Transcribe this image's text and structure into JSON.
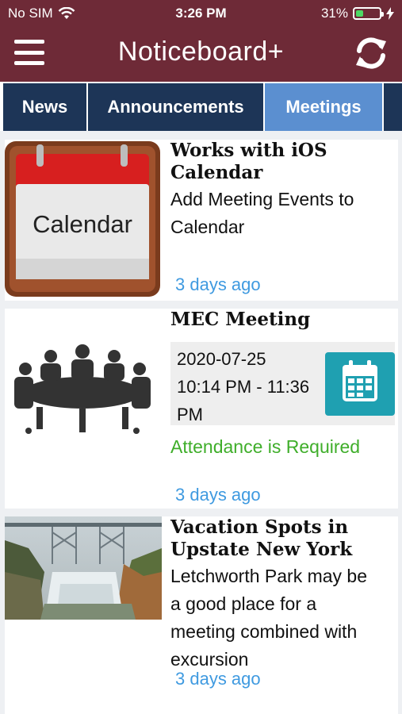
{
  "status_bar": {
    "carrier": "No SIM",
    "time": "3:26 PM",
    "battery": "31%",
    "battery_level": 0.31
  },
  "nav": {
    "title": "Noticeboard+"
  },
  "tabs": [
    {
      "label": "News",
      "active": false
    },
    {
      "label": "Announcements",
      "active": false
    },
    {
      "label": "Meetings",
      "active": true
    }
  ],
  "posts": [
    {
      "title": "Works with iOS Calendar",
      "body": "Add Meeting Events to Calendar",
      "time_ago": "3 days ago",
      "image_label": "Calendar"
    },
    {
      "title": "MEC Meeting",
      "date": "2020-07-25",
      "time_range": "10:14 PM - 11:36 PM",
      "attendance": "Attendance is Required",
      "time_ago": "3 days ago"
    },
    {
      "title": "Vacation Spots in Upstate New York",
      "body": "Letchworth Park may be a good place for a meeting combined with excursion",
      "time_ago": "3 days ago"
    }
  ],
  "colors": {
    "header": "#6e2a37",
    "tab": "#1d3557",
    "tab_active": "#5b8fd0",
    "link": "#3f9ae0",
    "attendance": "#3fae2a",
    "calendar_button": "#1fa0b1"
  }
}
